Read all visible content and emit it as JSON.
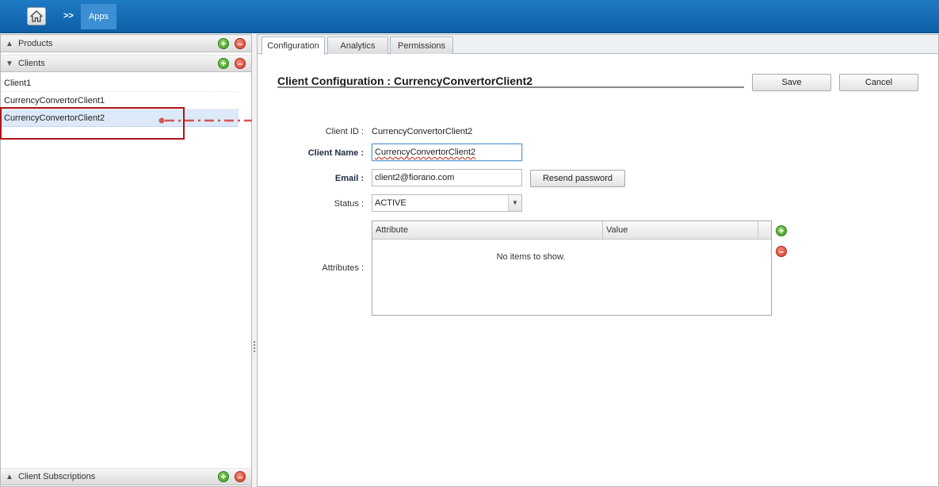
{
  "breadcrumb": {
    "home_icon": "home-icon",
    "separator": ">>",
    "current": "Apps"
  },
  "left_panel": {
    "products": {
      "title": "Products"
    },
    "clients": {
      "title": "Clients",
      "items": [
        {
          "label": "Client1"
        },
        {
          "label": "CurrencyConvertorClient1"
        },
        {
          "label": "CurrencyConvertorClient2",
          "selected": true
        }
      ]
    },
    "subscriptions": {
      "title": "Client Subscriptions"
    }
  },
  "tabs": [
    {
      "label": "Configuration",
      "active": true
    },
    {
      "label": "Analytics",
      "active": false
    },
    {
      "label": "Permissions",
      "active": false
    }
  ],
  "config": {
    "title": "Client Configuration : CurrencyConvertorClient2",
    "save_label": "Save",
    "cancel_label": "Cancel",
    "client_id_label": "Client ID :",
    "client_id_value": "CurrencyConvertorClient2",
    "client_name_label": "Client Name :",
    "client_name_value": "CurrencyConvertorClient2",
    "email_label": "Email :",
    "email_value": "client2@fiorano.com",
    "resend_label": "Resend password",
    "status_label": "Status :",
    "status_value": "ACTIVE",
    "attributes_label": "Attributes :",
    "attributes_grid": {
      "columns": [
        "Attribute",
        "Value"
      ],
      "empty_text": "No items to show."
    }
  },
  "colors": {
    "topbar": "#1f7ac4",
    "highlight": "#b0141c",
    "arrow": "#d9534f",
    "add": "#3b9a1e",
    "remove": "#d23b2b"
  }
}
